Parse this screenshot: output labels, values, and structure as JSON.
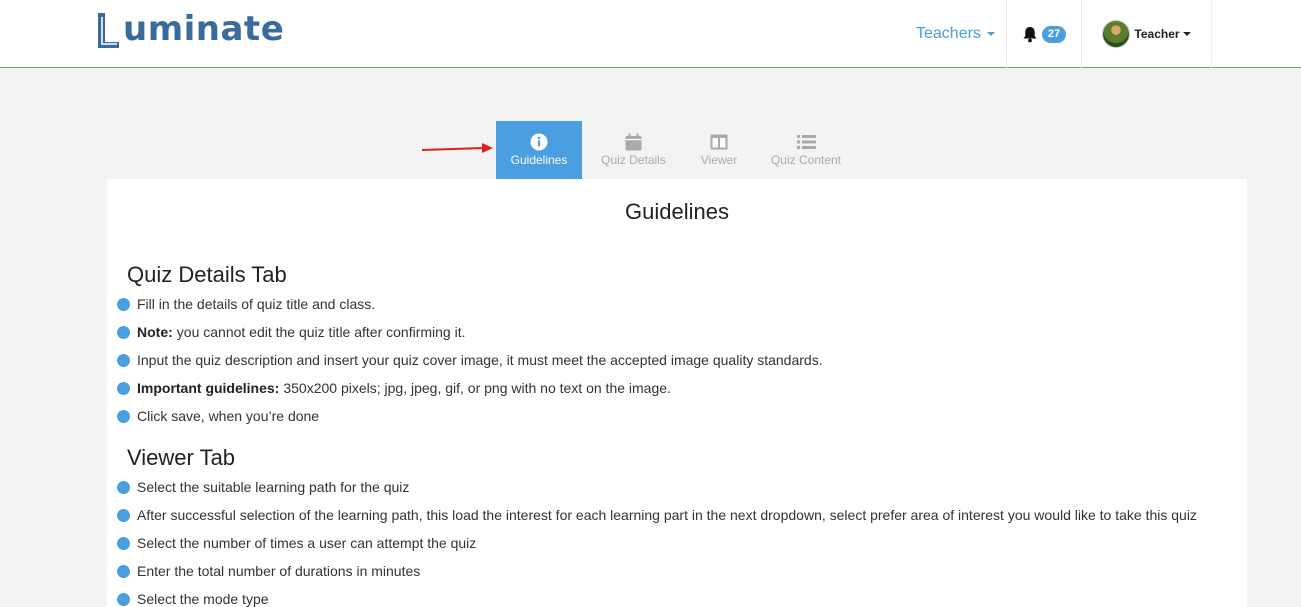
{
  "header": {
    "logo_text": "uminate",
    "nav_teachers": "Teachers",
    "notification_count": "27",
    "user_label": "Teacher"
  },
  "tabs": [
    {
      "label": "Guidelines",
      "icon": "info-circle-icon",
      "active": true
    },
    {
      "label": "Quiz Details",
      "icon": "calendar-icon",
      "active": false
    },
    {
      "label": "Viewer",
      "icon": "columns-icon",
      "active": false
    },
    {
      "label": "Quiz Content",
      "icon": "list-icon",
      "active": false
    }
  ],
  "card": {
    "title": "Guidelines",
    "sections": [
      {
        "title": "Quiz Details Tab",
        "items": [
          {
            "bold": "",
            "text": "Fill in the details of quiz title and class."
          },
          {
            "bold": "Note:",
            "text": "you cannot edit the quiz title after confirming it."
          },
          {
            "bold": "",
            "text": "Input the quiz description and insert your quiz cover image, it must meet the accepted image quality standards."
          },
          {
            "bold": "Important guidelines:",
            "text": "350x200 pixels; jpg, jpeg, gif, or png with no text on the image."
          },
          {
            "bold": "",
            "text": "Click save, when you’re done"
          }
        ]
      },
      {
        "title": "Viewer Tab",
        "items": [
          {
            "bold": "",
            "text": "Select the suitable learning path for the quiz"
          },
          {
            "bold": "",
            "text": "After successful selection of the learning path, this load the interest for each learning part in the next dropdown, select prefer area of interest you would like to take this quiz"
          },
          {
            "bold": "",
            "text": "Select the number of times a user can attempt the quiz"
          },
          {
            "bold": "",
            "text": "Enter the total number of durations in minutes"
          },
          {
            "bold": "",
            "text": "Select the mode type"
          }
        ]
      }
    ]
  },
  "colors": {
    "accent": "#4a9fe0",
    "logo": "#3a6b9b",
    "header_border": "#5cae4f",
    "arrow": "#e01e1e"
  }
}
